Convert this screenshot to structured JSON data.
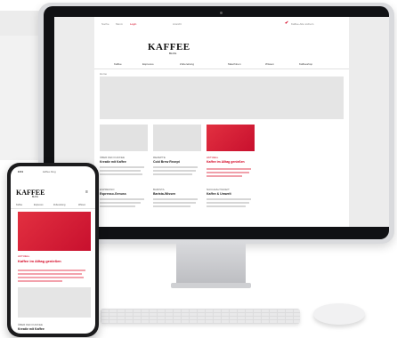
{
  "desktop": {
    "utility_links": [
      "Suche",
      "Menü",
      "Login",
      "Ansicht"
    ],
    "logo": "KAFFEE",
    "logo_sub": "BLOG",
    "promo": "Kaffee-Abo sichern",
    "nav": [
      "Kaffee",
      "Espresso",
      "Zubereitung",
      "Maschinen",
      "Wissen",
      "Kaffeeshop"
    ],
    "breadcrumb": "Home",
    "cards": [
      {
        "tag": "ÜBER DEN KAFFEE",
        "title": "Kreativ mit Kaffee"
      },
      {
        "tag": "REZEPTE",
        "title": "Cold Brew Rezept"
      },
      {
        "tag": "AKTUELL",
        "title": "Kaffee im Alltag genießen"
      },
      {
        "tag": "ESPRESSO",
        "title": "Espresso-Genuss"
      },
      {
        "tag": "BARISTA",
        "title": "Barista-Wissen"
      },
      {
        "tag": "NACHHALTIGKEIT",
        "title": "Kaffee & Umwelt"
      }
    ]
  },
  "phone": {
    "time": "9:41",
    "url": "kaffee.blog",
    "logo": "KAFFEE",
    "logo_sub": "BLOG",
    "menu_icon": "≡",
    "nav": [
      "Kaffee",
      "Espresso",
      "Zubereitung",
      "Wissen"
    ],
    "featured_tag": "AKTUELL",
    "featured_title": "Kaffee im Alltag genießen",
    "second_tag": "ÜBER DEN KAFFEE",
    "second_title": "Kreativ mit Kaffee"
  }
}
